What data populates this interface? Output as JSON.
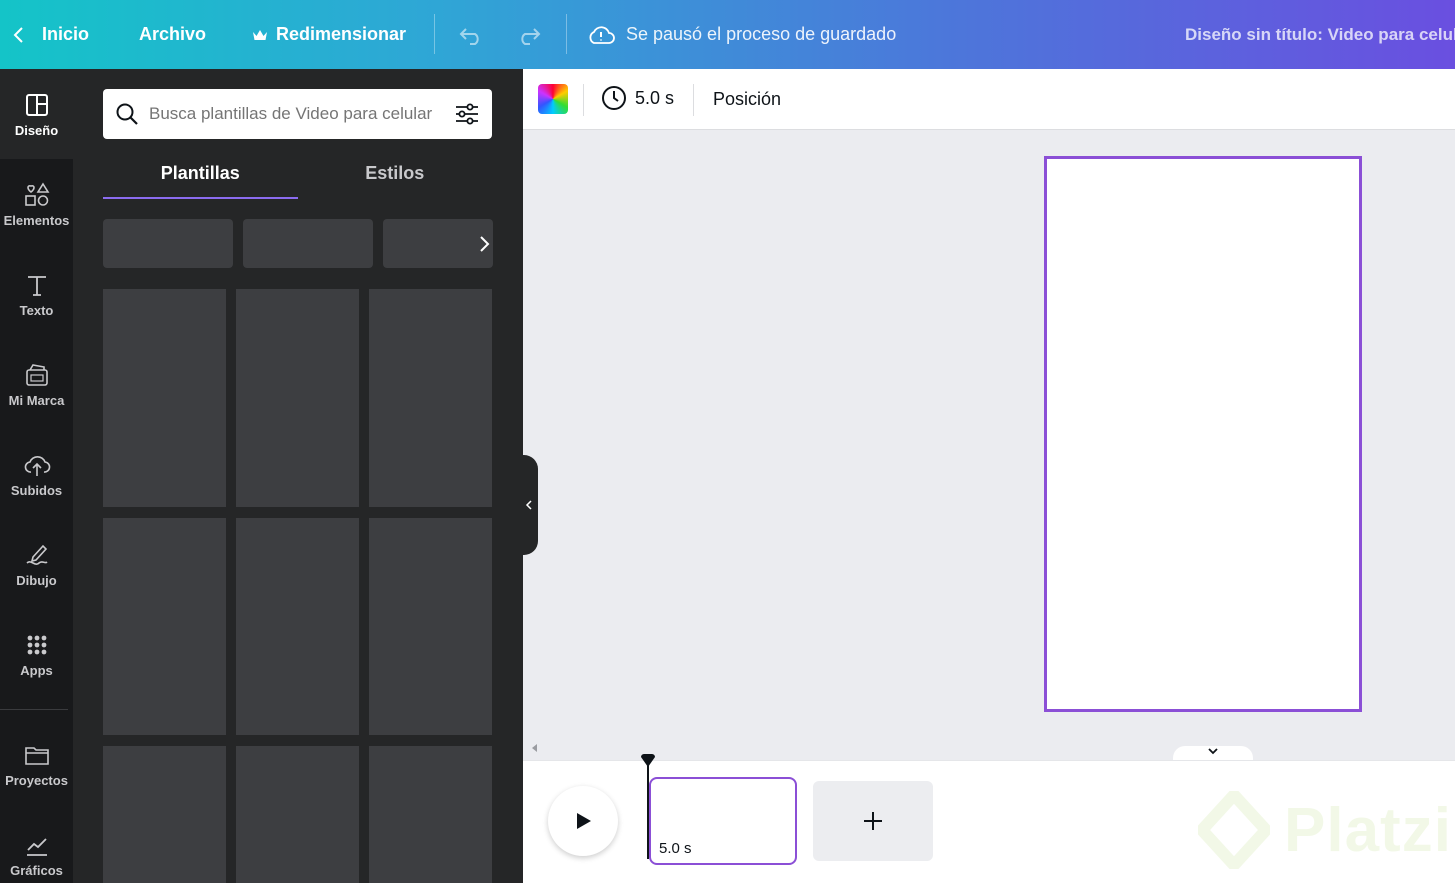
{
  "header": {
    "home_label": "Inicio",
    "file_label": "Archivo",
    "resize_label": "Redimensionar",
    "save_status": "Se pausó el proceso de guardado",
    "doc_title": "Diseño sin título: Video para celular"
  },
  "rail": {
    "items": [
      {
        "label": "Diseño",
        "icon": "layout-icon"
      },
      {
        "label": "Elementos",
        "icon": "shapes-icon"
      },
      {
        "label": "Texto",
        "icon": "text-icon"
      },
      {
        "label": "Mi Marca",
        "icon": "brand-kit-icon"
      },
      {
        "label": "Subidos",
        "icon": "cloud-upload-icon"
      },
      {
        "label": "Dibujo",
        "icon": "draw-icon"
      },
      {
        "label": "Apps",
        "icon": "apps-grid-icon"
      },
      {
        "label": "Proyectos",
        "icon": "folder-icon"
      },
      {
        "label": "Gráficos",
        "icon": "chart-icon"
      }
    ]
  },
  "panel": {
    "search_placeholder": "Busca plantillas de Video para celular",
    "tabs": [
      "Plantillas",
      "Estilos"
    ]
  },
  "toolbar": {
    "duration": "5.0 s",
    "position_label": "Posición"
  },
  "timeline": {
    "clip_duration": "5.0 s"
  },
  "watermark": {
    "text": "Platzi"
  },
  "colors": {
    "accent": "#8b4fd6",
    "panel_bg": "#252627",
    "rail_bg": "#18191b",
    "tile_bg": "#3d3e41"
  }
}
